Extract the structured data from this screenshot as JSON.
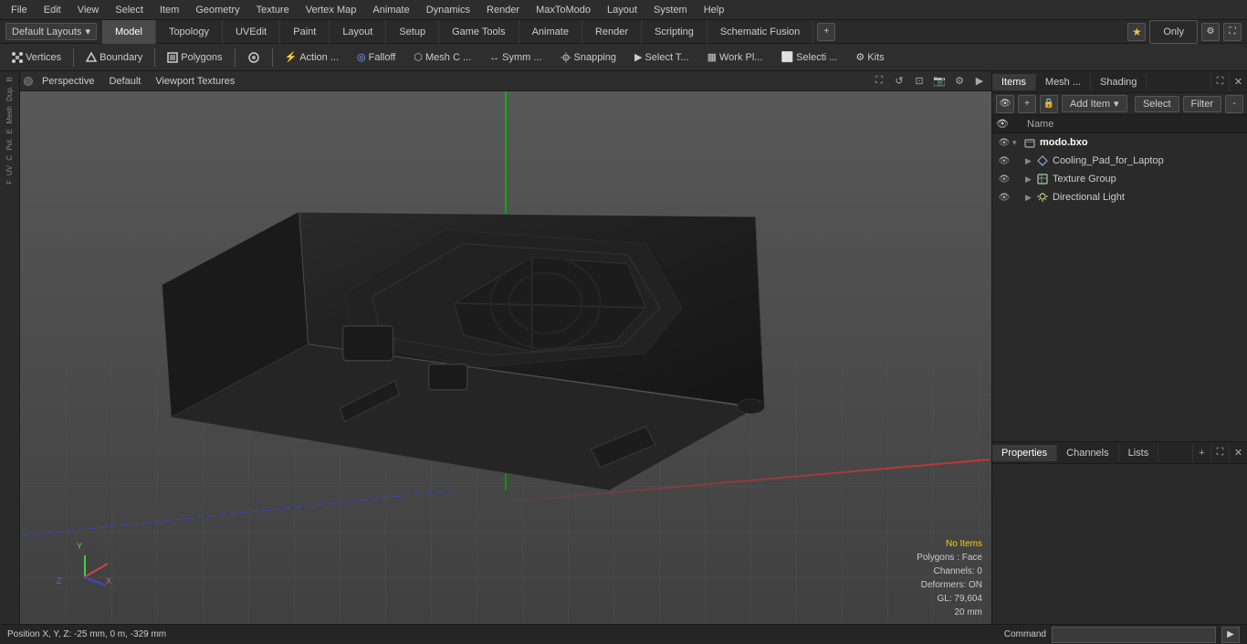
{
  "menubar": {
    "items": [
      "File",
      "Edit",
      "View",
      "Select",
      "Item",
      "Geometry",
      "Texture",
      "Vertex Map",
      "Animate",
      "Dynamics",
      "Render",
      "MaxToModo",
      "Layout",
      "System",
      "Help"
    ]
  },
  "layoutbar": {
    "dropdown": "Default Layouts",
    "tabs": [
      "Model",
      "Topology",
      "UVEdit",
      "Paint",
      "Layout",
      "Setup",
      "Game Tools",
      "Animate",
      "Render",
      "Scripting",
      "Schematic Fusion"
    ],
    "active_tab": 0,
    "only_btn": "Only",
    "plus_icon": "+"
  },
  "toolsbar": {
    "items": [
      {
        "label": "Vertices",
        "icon": "●",
        "type": "toggle"
      },
      {
        "label": "Boundary",
        "icon": "◇",
        "type": "toggle"
      },
      {
        "label": "Polygons",
        "icon": "▣",
        "type": "toggle"
      },
      {
        "label": "●",
        "type": "icon"
      },
      {
        "label": "Action ...",
        "icon": "⚡",
        "type": "btn"
      },
      {
        "label": "Falloff",
        "icon": "◎",
        "type": "btn"
      },
      {
        "label": "Mesh C ...",
        "icon": "⬡",
        "type": "btn"
      },
      {
        "label": "Symm ...",
        "icon": "↔",
        "type": "btn"
      },
      {
        "label": "Snapping",
        "icon": "🔗",
        "type": "btn"
      },
      {
        "label": "Select T...",
        "icon": "▶",
        "type": "btn"
      },
      {
        "label": "Work Pl...",
        "icon": "▦",
        "type": "btn"
      },
      {
        "label": "Selecti ...",
        "icon": "⬜",
        "type": "btn"
      },
      {
        "label": "Kits",
        "icon": "⚙",
        "type": "btn"
      }
    ]
  },
  "viewport": {
    "dot_label": "●",
    "name": "Perspective",
    "style": "Default",
    "shading": "Viewport Textures",
    "status": {
      "no_items": "No Items",
      "polygons": "Polygons : Face",
      "channels": "Channels: 0",
      "deformers": "Deformers: ON",
      "gl": "GL: 79,604",
      "size": "20 mm"
    },
    "position": "Position X, Y, Z:   -25 mm, 0 m, -329 mm"
  },
  "items_panel": {
    "tabs": [
      "Items",
      "Mesh ...",
      "Shading"
    ],
    "active_tab": 0,
    "add_item": "Add Item",
    "select_btn": "Select",
    "filter_btn": "Filter",
    "col_name": "Name",
    "items": [
      {
        "id": "root",
        "level": 0,
        "name": "modo.bxo",
        "icon": "box",
        "expanded": true,
        "visible": true,
        "eye": true
      },
      {
        "id": "mesh",
        "level": 1,
        "name": "Cooling_Pad_for_Laptop",
        "icon": "mesh",
        "expanded": false,
        "visible": true,
        "eye": true
      },
      {
        "id": "texgrp",
        "level": 1,
        "name": "Texture Group",
        "icon": "texgrp",
        "expanded": false,
        "visible": true,
        "eye": true
      },
      {
        "id": "light",
        "level": 1,
        "name": "Directional Light",
        "icon": "light",
        "expanded": false,
        "visible": true,
        "eye": true
      }
    ]
  },
  "properties_panel": {
    "tabs": [
      "Properties",
      "Channels",
      "Lists"
    ],
    "active_tab": 0
  },
  "statusbar": {
    "position_text": "Position X, Y, Z:   -25 mm, 0 m, -329 mm",
    "command_label": "Command",
    "command_placeholder": ""
  }
}
